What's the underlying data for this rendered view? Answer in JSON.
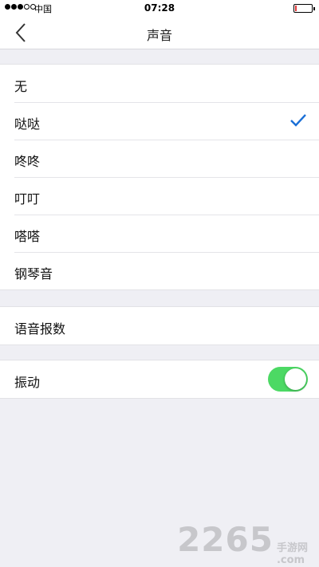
{
  "status_bar": {
    "carrier": "中国",
    "time": "07:28",
    "signal_bars_filled": 3,
    "signal_bars_total": 5,
    "battery_level": 0.12,
    "battery_color": "#e23b3b"
  },
  "nav": {
    "back_icon": "chevron-left-icon",
    "title": "声音"
  },
  "sound_options": [
    {
      "label": "无",
      "selected": false
    },
    {
      "label": "哒哒",
      "selected": true
    },
    {
      "label": "咚咚",
      "selected": false
    },
    {
      "label": "叮叮",
      "selected": false
    },
    {
      "label": "嗒嗒",
      "selected": false
    },
    {
      "label": "钢琴音",
      "selected": false
    }
  ],
  "voice_report": {
    "label": "语音报数"
  },
  "vibration": {
    "label": "振动",
    "enabled": true,
    "toggle_color": "#4cd964"
  },
  "accent_color": "#1a6fd6",
  "watermark": {
    "number": "2265",
    "text": "手游网",
    "suffix": ".com"
  }
}
